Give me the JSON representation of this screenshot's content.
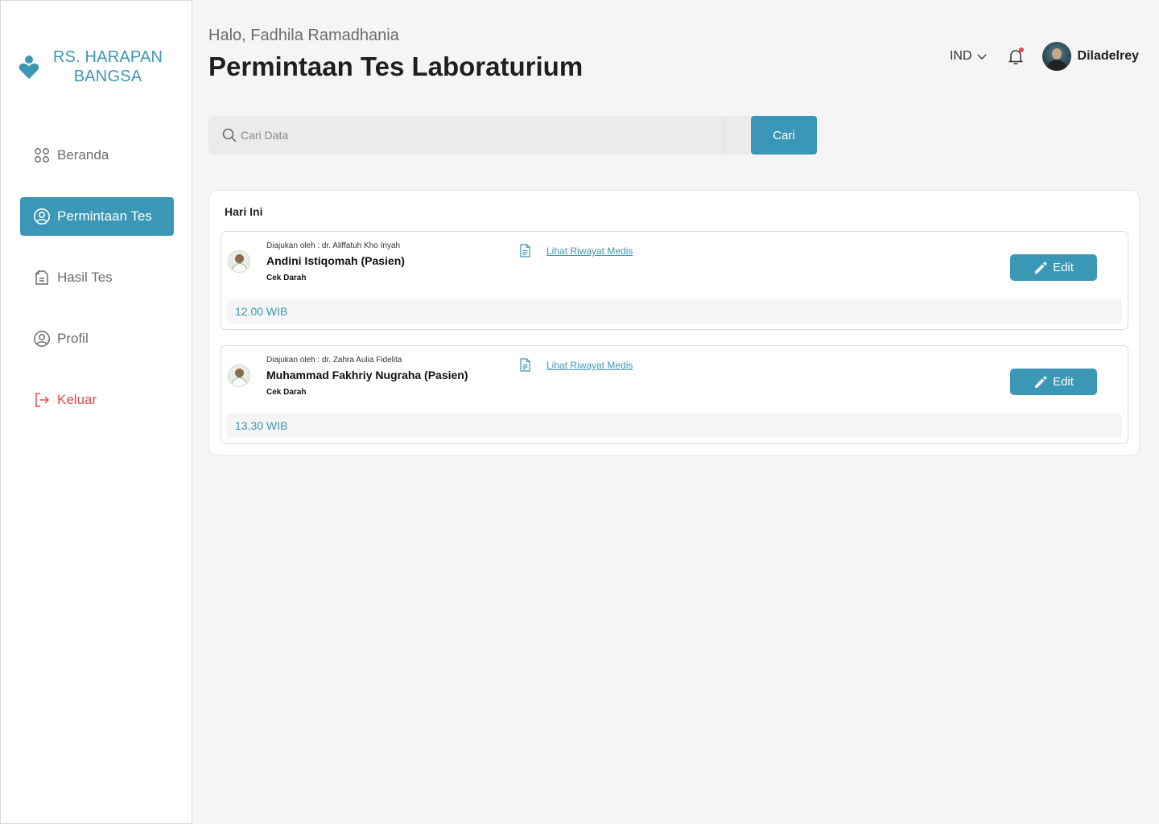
{
  "sidebar": {
    "brand": "RS. HARAPAN BANGSA",
    "items": [
      {
        "label": "Beranda",
        "icon": "grid-icon"
      },
      {
        "label": "Permintaan Tes",
        "icon": "user-circle-icon",
        "active": true
      },
      {
        "label": "Hasil Tes",
        "icon": "document-icon"
      },
      {
        "label": "Profil",
        "icon": "user-circle-icon"
      },
      {
        "label": "Keluar",
        "icon": "logout-icon"
      }
    ]
  },
  "header": {
    "greeting": "Halo,  Fadhila Ramadhania",
    "title": "Permintaan Tes Laboraturium",
    "language": "IND",
    "username": "Diladelrey",
    "has_notification": true
  },
  "search": {
    "placeholder": "Cari Data",
    "value": "",
    "button_label": "Cari"
  },
  "requests": {
    "section_title": "Hari Ini",
    "items": [
      {
        "submitted_by": "Diajukan oleh : dr. Aliffatuh Kho Iriyah",
        "patient": "Andini Istiqomah (Pasien)",
        "test_type": "Cek Darah",
        "medical_link": "Lihat Riwayat Medis",
        "edit_label": "Edit",
        "time": "12.00 WIB"
      },
      {
        "submitted_by": "Diajukan oleh : dr. Zahra Aulia Fidelita",
        "patient": "Muhammad Fakhriy Nugraha (Pasien)",
        "test_type": "Cek Darah",
        "medical_link": "Lihat Riwayat Medis",
        "edit_label": "Edit",
        "time": "13.30 WIB"
      }
    ]
  },
  "colors": {
    "accent": "#3b97b6",
    "danger": "#e5484d",
    "background": "#f5f5f5"
  }
}
